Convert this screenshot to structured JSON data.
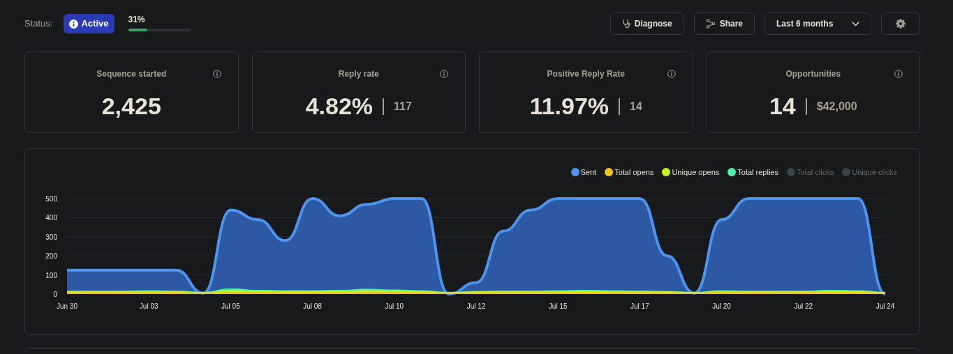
{
  "status": {
    "label": "Status:",
    "badge": "Active",
    "progress_text": "31%",
    "level": 0.31
  },
  "toolbar": {
    "buttons": [
      {
        "kind": "diagnose",
        "label": "Diagnose"
      },
      {
        "kind": "share",
        "label": "Share"
      }
    ],
    "range_select": {
      "value": "Last 6 months"
    }
  },
  "stats": [
    {
      "title": "Sequence started",
      "value": "2,425"
    },
    {
      "title": "Reply rate",
      "value": "4.82%",
      "secondary": "117"
    },
    {
      "title": "Positive Reply Rate",
      "value": "11.97%",
      "secondary": "14"
    },
    {
      "title": "Opportunities",
      "value": "14",
      "secondary": "$42,000"
    }
  ],
  "chart": {
    "hidden_legend": [
      {
        "label": "Total clicks",
        "color": "#3a4448",
        "hidden": true
      },
      {
        "label": "Unique clicks",
        "color": "#3a4448",
        "hidden": true
      }
    ]
  },
  "chart_data": {
    "type": "area",
    "grid": true,
    "categories": [
      "Jun 30",
      null,
      null,
      "Jul 03",
      null,
      null,
      "Jul 05",
      null,
      null,
      "Jul 08",
      null,
      null,
      "Jul 10",
      null,
      null,
      "Jul 12",
      null,
      null,
      "Jul 15",
      null,
      null,
      "Jul 17",
      null,
      null,
      "Jul 20",
      null,
      null,
      "Jul 22",
      null,
      null,
      "Jul 24"
    ],
    "yticks": [
      0,
      100,
      200,
      300,
      400,
      500
    ],
    "ylim": [
      0,
      500
    ],
    "series": [
      {
        "name": "Sent",
        "color": "#4d94ef",
        "values": [
          125,
          125,
          125,
          125,
          125,
          5,
          440,
          390,
          280,
          500,
          410,
          470,
          500,
          500,
          0,
          60,
          330,
          440,
          500,
          500,
          500,
          500,
          200,
          5,
          390,
          500,
          500,
          500,
          500,
          500,
          0
        ]
      },
      {
        "name": "Total opens",
        "color": "#f5c21f",
        "values": [
          7,
          7,
          7,
          7,
          7,
          5,
          8,
          8,
          7,
          7,
          7,
          8,
          8,
          7,
          5,
          6,
          7,
          7,
          7,
          7,
          7,
          7,
          6,
          5,
          7,
          7,
          7,
          7,
          7,
          7,
          5
        ]
      },
      {
        "name": "Unique opens",
        "color": "#c5f51a",
        "values": [
          13,
          13,
          13,
          14,
          13,
          8,
          18,
          16,
          15,
          15,
          16,
          18,
          17,
          15,
          8,
          12,
          14,
          14,
          14,
          15,
          14,
          14,
          12,
          8,
          14,
          13,
          13,
          13,
          15,
          15,
          8
        ]
      },
      {
        "name": "Total replies",
        "color": "#4df0a8",
        "values": [
          16,
          16,
          16,
          18,
          16,
          10,
          28,
          20,
          18,
          18,
          20,
          26,
          22,
          18,
          10,
          14,
          16,
          16,
          18,
          20,
          18,
          16,
          14,
          10,
          18,
          16,
          16,
          16,
          20,
          18,
          10
        ]
      }
    ]
  }
}
